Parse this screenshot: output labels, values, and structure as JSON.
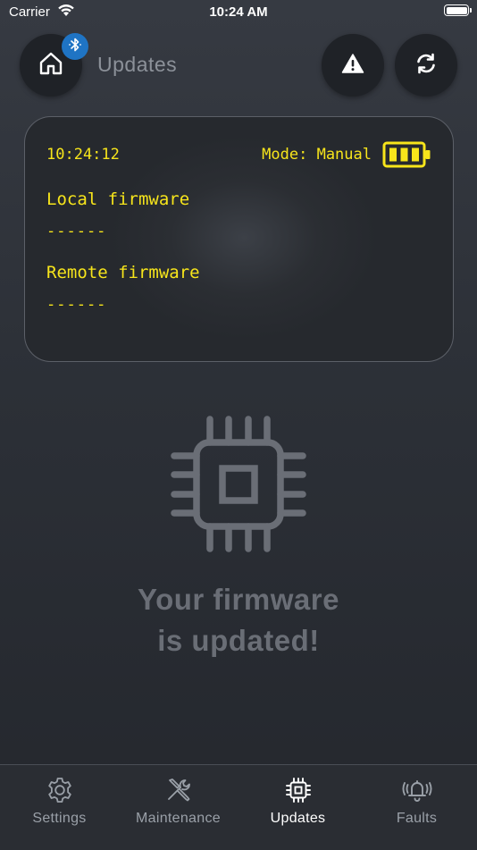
{
  "status_bar": {
    "carrier": "Carrier",
    "time": "10:24 AM"
  },
  "header": {
    "title": "Updates",
    "home_icon": "home-icon",
    "bluetooth_icon": "bluetooth-icon",
    "alert_icon": "warning-icon",
    "refresh_icon": "refresh-icon"
  },
  "display": {
    "time": "10:24:12",
    "mode": "Mode: Manual",
    "battery_icon": "battery-icon",
    "battery_bars": 3,
    "local_label": "Local firmware",
    "local_value": "------",
    "remote_label": "Remote firmware",
    "remote_value": "------",
    "text_color": "#f7e51b"
  },
  "main": {
    "icon": "chip-icon",
    "message_line1": "Your firmware",
    "message_line2": "is updated!"
  },
  "tabs": [
    {
      "label": "Settings",
      "icon": "gear-icon",
      "active": false
    },
    {
      "label": "Maintenance",
      "icon": "tools-icon",
      "active": false
    },
    {
      "label": "Updates",
      "icon": "chip-icon",
      "active": true
    },
    {
      "label": "Faults",
      "icon": "alarm-bell-icon",
      "active": false
    }
  ],
  "colors": {
    "accent_bluetooth": "#1f74c4",
    "display_text": "#f7e51b",
    "muted_text": "#6a6e76"
  }
}
